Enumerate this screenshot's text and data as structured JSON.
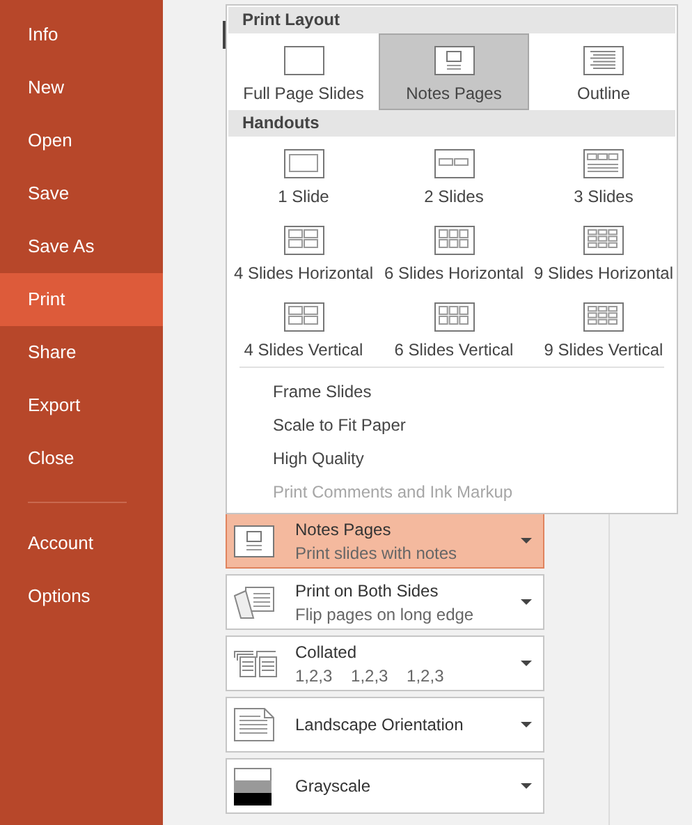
{
  "sidebar": {
    "items": [
      {
        "label": "Info",
        "selected": false
      },
      {
        "label": "New",
        "selected": false
      },
      {
        "label": "Open",
        "selected": false
      },
      {
        "label": "Save",
        "selected": false
      },
      {
        "label": "Save As",
        "selected": false
      },
      {
        "label": "Print",
        "selected": true
      },
      {
        "label": "Share",
        "selected": false
      },
      {
        "label": "Export",
        "selected": false
      },
      {
        "label": "Close",
        "selected": false
      }
    ],
    "bottom_items": [
      {
        "label": "Account",
        "selected": false
      },
      {
        "label": "Options",
        "selected": false
      }
    ]
  },
  "layout_menu": {
    "sections": [
      {
        "title": "Print Layout",
        "items": [
          {
            "label": "Full Page Slides",
            "kind": "full",
            "selected": false
          },
          {
            "label": "Notes Pages",
            "kind": "notes",
            "selected": true
          },
          {
            "label": "Outline",
            "kind": "outline",
            "selected": false
          }
        ]
      },
      {
        "title": "Handouts",
        "items": [
          {
            "label": "1 Slide",
            "kind": "grid1",
            "selected": false
          },
          {
            "label": "2 Slides",
            "kind": "grid2",
            "selected": false
          },
          {
            "label": "3 Slides",
            "kind": "grid3",
            "selected": false
          },
          {
            "label": "4 Slides Horizontal",
            "kind": "grid4",
            "selected": false
          },
          {
            "label": "6 Slides Horizontal",
            "kind": "grid6",
            "selected": false
          },
          {
            "label": "9 Slides Horizontal",
            "kind": "grid9",
            "selected": false
          },
          {
            "label": "4 Slides Vertical",
            "kind": "grid4",
            "selected": false
          },
          {
            "label": "6 Slides Vertical",
            "kind": "grid6",
            "selected": false
          },
          {
            "label": "9 Slides Vertical",
            "kind": "grid9",
            "selected": false
          }
        ]
      }
    ],
    "options": [
      {
        "label": "Frame Slides",
        "disabled": false
      },
      {
        "label": "Scale to Fit Paper",
        "disabled": false
      },
      {
        "label": "High Quality",
        "disabled": false
      },
      {
        "label": "Print Comments and Ink Markup",
        "disabled": true
      }
    ]
  },
  "settings": [
    {
      "kind": "notes",
      "title": "Notes Pages",
      "subtitle": "Print slides with notes",
      "open": true
    },
    {
      "kind": "duplex",
      "title": "Print on Both Sides",
      "subtitle": "Flip pages on long edge",
      "open": false
    },
    {
      "kind": "collated",
      "title": "Collated",
      "subtitle": "1,2,3    1,2,3    1,2,3",
      "open": false
    },
    {
      "kind": "landscape",
      "title": "Landscape Orientation",
      "open": false
    },
    {
      "kind": "grayscale",
      "title": "Grayscale",
      "open": false
    }
  ]
}
